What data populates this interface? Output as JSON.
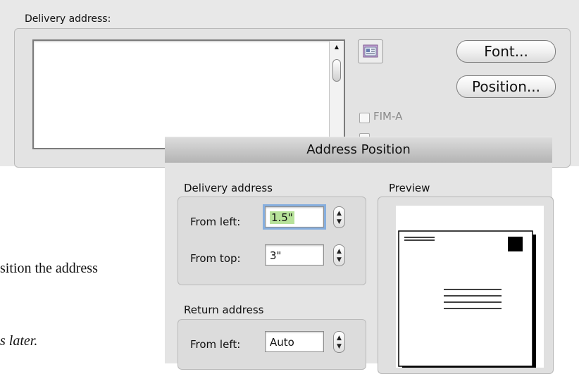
{
  "envelope_dialog": {
    "delivery_address_label": "Delivery address:",
    "font_button": "Font...",
    "position_button": "Position...",
    "fim_a_label": "FIM-A"
  },
  "address_position_dialog": {
    "title": "Address Position",
    "delivery_section_label": "Delivery address",
    "preview_label": "Preview",
    "from_left_label": "From left:",
    "from_left_value": "1.5\"",
    "from_top_label": "From top:",
    "from_top_value": "3\"",
    "return_section_label": "Return address",
    "return_from_left_label": "From left:",
    "return_from_left_value": "Auto"
  },
  "document": {
    "line_1": "sition the address",
    "line_2": "s later."
  },
  "icons": {
    "address_book": "address-book-icon",
    "scroll_up": "scroll-up-arrow-icon",
    "stepper": "stepper-icon"
  }
}
